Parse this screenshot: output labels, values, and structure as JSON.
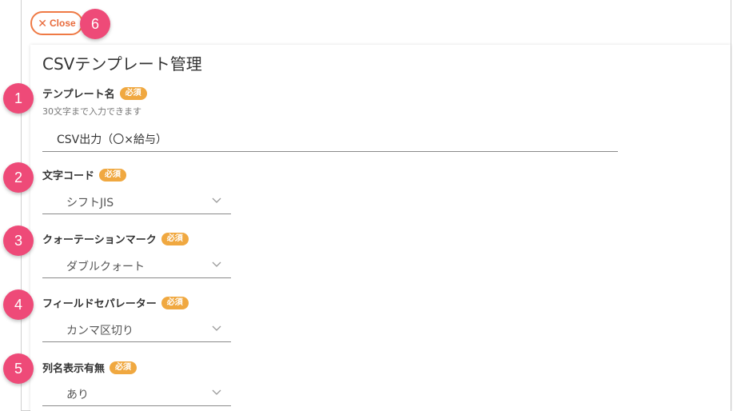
{
  "close": {
    "label": "Close",
    "icon": "close-icon"
  },
  "page_title": "CSVテンプレート管理",
  "required_label": "必須",
  "badges": [
    "1",
    "2",
    "3",
    "4",
    "5",
    "6"
  ],
  "fields": {
    "template_name": {
      "label": "テンプレート名",
      "hint": "30文字まで入力できます",
      "value": "CSV出力（〇×給与）"
    },
    "encoding": {
      "label": "文字コード",
      "value": "シフトJIS"
    },
    "quote_mark": {
      "label": "クォーテーションマーク",
      "value": "ダブルクォート"
    },
    "field_separator": {
      "label": "フィールドセパレーター",
      "value": "カンマ区切り"
    },
    "column_names": {
      "label": "列名表示有無",
      "value": "あり"
    }
  },
  "colors": {
    "badge": "#ee4a78",
    "required": "#f0a840",
    "close_accent": "#ef7a45"
  }
}
